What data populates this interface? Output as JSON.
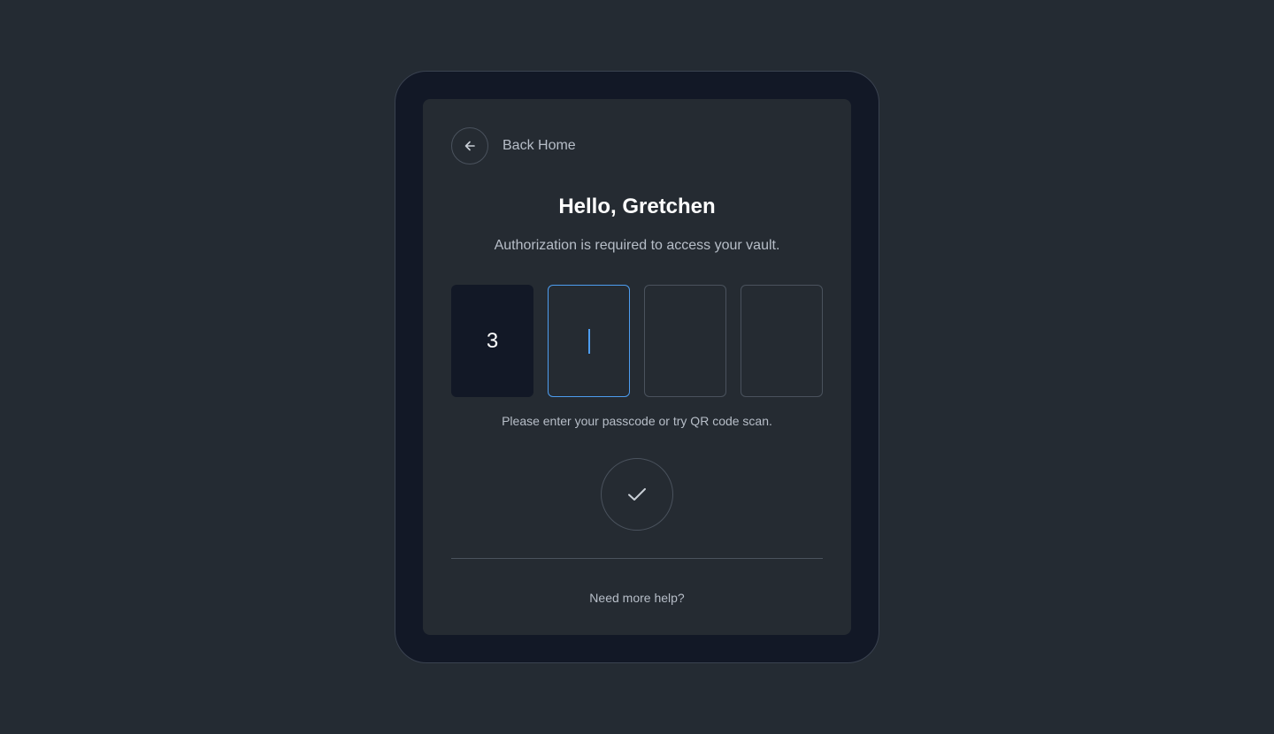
{
  "nav": {
    "back_label": "Back Home",
    "back_icon": "arrow-left-icon"
  },
  "header": {
    "title": "Hello, Gretchen",
    "subtitle": "Authorization is required to access your vault."
  },
  "passcode": {
    "digits": [
      "3",
      "",
      "",
      ""
    ],
    "active_index": 1,
    "hint": "Please enter your passcode or try QR code scan."
  },
  "submit": {
    "icon": "check-icon"
  },
  "footer": {
    "help_label": "Need more help?"
  },
  "colors": {
    "background": "#242b33",
    "device": "#121826",
    "screen": "#252b32",
    "accent": "#4d9df0",
    "text_primary": "#ffffff",
    "text_secondary": "#b7bec8"
  }
}
